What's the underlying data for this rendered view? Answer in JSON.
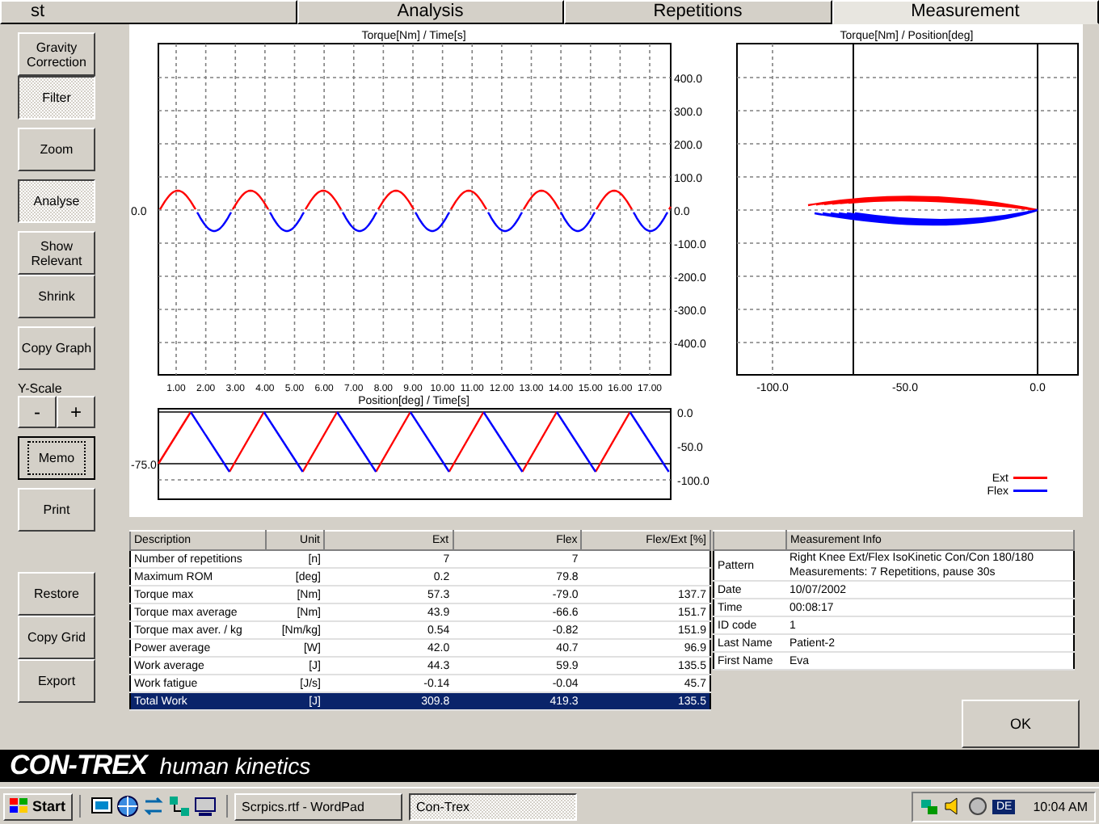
{
  "tabs": [
    {
      "label": "st",
      "selected": false
    },
    {
      "label": "Analysis",
      "selected": false
    },
    {
      "label": "Repetitions",
      "selected": false
    },
    {
      "label": "Measurement",
      "selected": true
    }
  ],
  "sidebar": {
    "groups": [
      [
        {
          "kind": "button",
          "label": "Gravity Correction",
          "pressed": false,
          "focused": false
        },
        {
          "kind": "button",
          "label": "Filter",
          "pressed": true,
          "focused": false
        }
      ],
      [
        {
          "kind": "button",
          "label": "Zoom",
          "pressed": false,
          "focused": false
        }
      ],
      [
        {
          "kind": "button",
          "label": "Analyse",
          "pressed": true,
          "focused": false
        }
      ],
      [
        {
          "kind": "button",
          "label": "Show Relevant",
          "pressed": false,
          "focused": false
        },
        {
          "kind": "button",
          "label": "Shrink",
          "pressed": false,
          "focused": false
        }
      ],
      [
        {
          "kind": "button",
          "label": "Copy Graph",
          "pressed": false,
          "focused": false
        }
      ],
      [
        {
          "kind": "label",
          "label": "Y-Scale"
        },
        {
          "kind": "stepper",
          "minus": "-",
          "plus": "+"
        }
      ],
      [
        {
          "kind": "button",
          "label": "Memo",
          "pressed": false,
          "focused": true
        }
      ],
      [
        {
          "kind": "button",
          "label": "Print",
          "pressed": false,
          "focused": false
        }
      ],
      [
        {
          "kind": "button",
          "label": "Restore",
          "pressed": false,
          "focused": false
        },
        {
          "kind": "button",
          "label": "Copy Grid",
          "pressed": false,
          "focused": false
        },
        {
          "kind": "button",
          "label": "Export",
          "pressed": false,
          "focused": false
        }
      ]
    ]
  },
  "torque_chart": {
    "title": "Torque[Nm] / Time[s]",
    "zero_label": "0.0",
    "y_ticks": [
      "400.0",
      "300.0",
      "200.0",
      "100.0",
      "0.0",
      "-100.0",
      "-200.0",
      "-300.0",
      "-400.0"
    ],
    "x_ticks": [
      "1.00",
      "2.00",
      "3.00",
      "4.00",
      "5.00",
      "6.00",
      "7.00",
      "8.00",
      "9.00",
      "10.00",
      "11.00",
      "12.00",
      "13.00",
      "14.00",
      "15.00",
      "16.00",
      "17.00"
    ]
  },
  "position_chart": {
    "title": "Position[deg] / Time[s]",
    "left_label": "-75.0",
    "y_ticks": [
      "0.0",
      "-50.0",
      "-100.0"
    ]
  },
  "loop_chart": {
    "title": "Torque[Nm] / Position[deg]",
    "x_ticks": [
      "-100.0",
      "-50.0",
      "0.0"
    ],
    "legend": [
      {
        "label": "Ext",
        "color": "#ff0000"
      },
      {
        "label": "Flex",
        "color": "#0000ff"
      }
    ]
  },
  "results_table": {
    "columns": [
      "Description",
      "Unit",
      "Ext",
      "Flex",
      "Flex/Ext [%]"
    ],
    "rows": [
      {
        "cells": [
          "Number of repetitions",
          "[n]",
          "7",
          "7",
          ""
        ],
        "selected": false
      },
      {
        "cells": [
          "Maximum ROM",
          "[deg]",
          "0.2",
          "79.8",
          ""
        ],
        "selected": false
      },
      {
        "cells": [
          "Torque max",
          "[Nm]",
          "57.3",
          "-79.0",
          "137.7"
        ],
        "selected": false
      },
      {
        "cells": [
          "Torque max average",
          "[Nm]",
          "43.9",
          "-66.6",
          "151.7"
        ],
        "selected": false
      },
      {
        "cells": [
          "Torque max aver. / kg",
          "[Nm/kg]",
          "0.54",
          "-0.82",
          "151.9"
        ],
        "selected": false
      },
      {
        "cells": [
          "Power average",
          "[W]",
          "42.0",
          "40.7",
          "96.9"
        ],
        "selected": false
      },
      {
        "cells": [
          "Work average",
          "[J]",
          "44.3",
          "59.9",
          "135.5"
        ],
        "selected": false
      },
      {
        "cells": [
          "Work fatigue",
          "[J/s]",
          "-0.14",
          "-0.04",
          "45.7"
        ],
        "selected": false
      },
      {
        "cells": [
          "Total Work",
          "[J]",
          "309.8",
          "419.3",
          "135.5"
        ],
        "selected": true
      }
    ]
  },
  "info_table": {
    "header": "Measurement Info",
    "rows": [
      {
        "label": "Pattern",
        "lines": [
          "Right Knee Ext/Flex IsoKinetic Con/Con 180/180",
          "Measurements: 7 Repetitions, pause 30s"
        ]
      },
      {
        "label": "Date",
        "lines": [
          "10/07/2002"
        ]
      },
      {
        "label": "Time",
        "lines": [
          "00:08:17"
        ]
      },
      {
        "label": "ID code",
        "lines": [
          "1"
        ]
      },
      {
        "label": "Last Name",
        "lines": [
          "Patient-2"
        ]
      },
      {
        "label": "First Name",
        "lines": [
          "Eva"
        ]
      }
    ]
  },
  "ok_button": "OK",
  "brand": {
    "name": "CON-TREX",
    "tagline": "human kinetics"
  },
  "taskbar": {
    "start": "Start",
    "tasks": [
      {
        "label": "Scrpics.rtf - WordPad",
        "selected": false
      },
      {
        "label": "Con-Trex",
        "selected": true
      }
    ],
    "tray_text": "DE",
    "clock": "10:04 AM"
  }
}
